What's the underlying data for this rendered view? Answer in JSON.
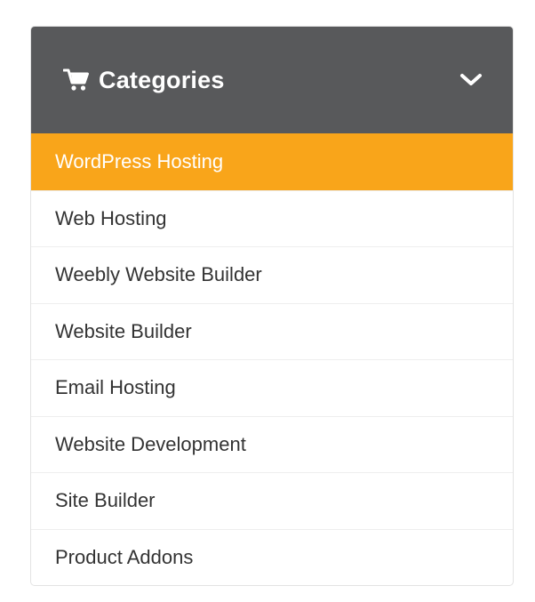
{
  "categories": {
    "title": "Categories",
    "items": [
      {
        "label": "WordPress Hosting",
        "active": true
      },
      {
        "label": "Web Hosting",
        "active": false
      },
      {
        "label": "Weebly Website Builder",
        "active": false
      },
      {
        "label": "Website Builder",
        "active": false
      },
      {
        "label": "Email Hosting",
        "active": false
      },
      {
        "label": "Website Development",
        "active": false
      },
      {
        "label": "Site Builder",
        "active": false
      },
      {
        "label": "Product Addons",
        "active": false
      }
    ]
  },
  "icons": {
    "header_icon": "shopping-cart-icon",
    "toggle_icon": "chevron-down-icon"
  },
  "colors": {
    "header_bg": "#58595b",
    "active_bg": "#f9a51a",
    "text": "#333333"
  }
}
